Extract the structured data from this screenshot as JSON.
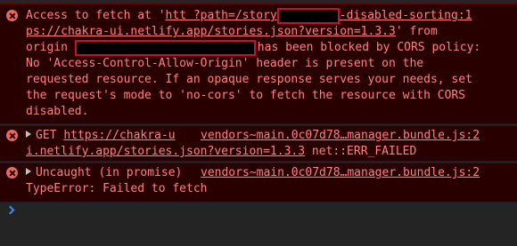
{
  "messages": [
    {
      "lines": [
        [
          "Access to fetch at '",
          "htt ?path=/story",
          "-disabled-sorting:1"
        ],
        [
          "ps://chakra-ui.netlify.app/stories.json?version=1.3.3",
          "' from"
        ],
        [
          "origin ",
          "has been blocked by CORS policy:"
        ],
        [
          "No 'Access-Control-Allow-Origin' header is present on the"
        ],
        [
          "requested resource. If an opaque response serves your needs, set"
        ],
        [
          "the request's mode to 'no-cors' to fetch the resource with CORS"
        ],
        [
          "disabled."
        ]
      ]
    },
    {
      "method": "GET",
      "url_part1": "https://chakra-u",
      "source": "vendors~main.0c07d78…manager.bundle.js:2",
      "url_part2": "i.netlify.app/stories.json?version=1.3.3",
      "status": " net::ERR_FAILED"
    },
    {
      "title": "Uncaught (in promise)",
      "source": "vendors~main.0c07d78…manager.bundle.js:2",
      "error": "TypeError: Failed to fetch"
    }
  ],
  "colors": {
    "error_bg": "#290000",
    "error_text": "#ff8080",
    "prompt": "#3d8af7",
    "redaction_border": "#c8102e"
  },
  "icons": {
    "error": "error-circle-icon",
    "expand": "expand-triangle-icon",
    "prompt": "prompt-chevron-icon"
  }
}
